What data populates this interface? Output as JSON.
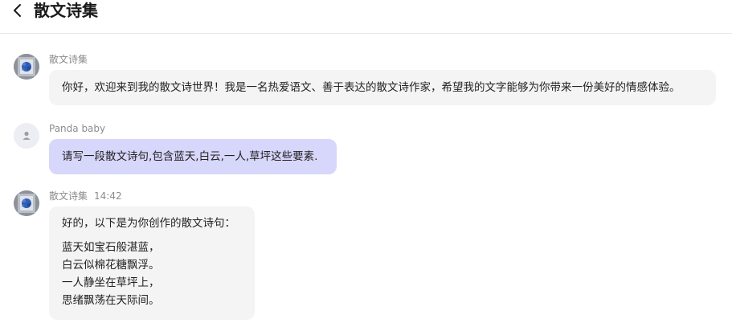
{
  "header": {
    "title": "散文诗集",
    "back_icon": "chevron-left-icon"
  },
  "messages": [
    {
      "sender": "散文诗集",
      "time": "",
      "text": "你好，欢迎来到我的散文诗世界！我是一名热爱语文、善于表达的散文诗作家，希望我的文字能够为你带来一份美好的情感体验。"
    },
    {
      "sender": "Panda baby",
      "time": "",
      "text": "请写一段散文诗句,包含蓝天,白云,一人,草坪这些要素."
    },
    {
      "sender": "散文诗集",
      "time": "14:42",
      "intro": "好的，以下是为你创作的散文诗句：",
      "lines": [
        "蓝天如宝石般湛蓝，",
        "白云似棉花糖飘浮。",
        "一人静坐在草坪上，",
        "思绪飘荡在天际间。"
      ]
    }
  ],
  "colors": {
    "bot_bubble": "#f4f4f5",
    "user_bubble": "#d7d6fb",
    "meta_text": "#8c8c8c"
  }
}
